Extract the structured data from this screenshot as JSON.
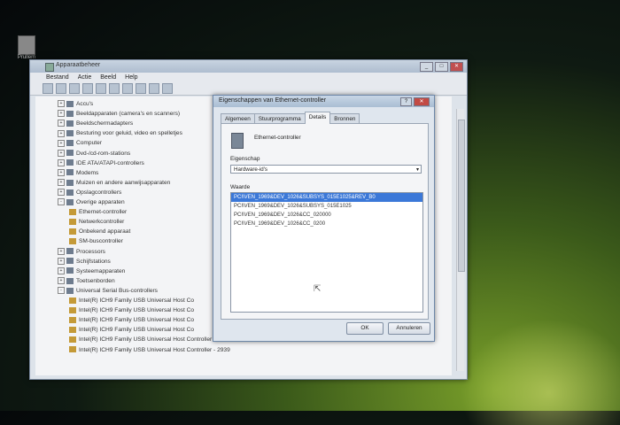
{
  "desktop": {
    "icon_label": "Prullem"
  },
  "device_manager": {
    "title": "Apparaatbeheer",
    "window_buttons": [
      "_",
      "□",
      "✕"
    ],
    "menu": [
      "Bestand",
      "Actie",
      "Beeld",
      "Help"
    ],
    "tree": [
      {
        "label": "Accu's",
        "level": 1,
        "expander": "+"
      },
      {
        "label": "Beeldapparaten (camera's en scanners)",
        "level": 1,
        "expander": "+"
      },
      {
        "label": "Beeldschermadapters",
        "level": 1,
        "expander": "+"
      },
      {
        "label": "Besturing voor geluid, video en spelletjes",
        "level": 1,
        "expander": "+"
      },
      {
        "label": "Computer",
        "level": 1,
        "expander": "+"
      },
      {
        "label": "Dvd-/cd-rom-stations",
        "level": 1,
        "expander": "+"
      },
      {
        "label": "IDE ATA/ATAPI-controllers",
        "level": 1,
        "expander": "+"
      },
      {
        "label": "Modems",
        "level": 1,
        "expander": "+"
      },
      {
        "label": "Muizen en andere aanwijsapparaten",
        "level": 1,
        "expander": "+"
      },
      {
        "label": "Opslagcontrollers",
        "level": 1,
        "expander": "+"
      },
      {
        "label": "Overige apparaten",
        "level": 1,
        "expander": "-"
      },
      {
        "label": "Ethernet-controller",
        "level": 2,
        "expander": ""
      },
      {
        "label": "Netwerkcontroller",
        "level": 2,
        "expander": ""
      },
      {
        "label": "Onbekend apparaat",
        "level": 2,
        "expander": ""
      },
      {
        "label": "SM-buscontroller",
        "level": 2,
        "expander": ""
      },
      {
        "label": "Processors",
        "level": 1,
        "expander": "+"
      },
      {
        "label": "Schijfstations",
        "level": 1,
        "expander": "+"
      },
      {
        "label": "Systeemapparaten",
        "level": 1,
        "expander": "+"
      },
      {
        "label": "Toetsenborden",
        "level": 1,
        "expander": "+"
      },
      {
        "label": "Universal Serial Bus-controllers",
        "level": 1,
        "expander": "-"
      },
      {
        "label": "Intel(R) ICH9 Family USB Universal Host Co",
        "level": 2,
        "expander": ""
      },
      {
        "label": "Intel(R) ICH9 Family USB Universal Host Co",
        "level": 2,
        "expander": ""
      },
      {
        "label": "Intel(R) ICH9 Family USB Universal Host Co",
        "level": 2,
        "expander": ""
      },
      {
        "label": "Intel(R) ICH9 Family USB Universal Host Co",
        "level": 2,
        "expander": ""
      },
      {
        "label": "Intel(R) ICH9 Family USB Universal Host Controller - 2938",
        "level": 2,
        "expander": ""
      },
      {
        "label": "Intel(R) ICH9 Family USB Universal Host Controller - 2939",
        "level": 2,
        "expander": ""
      }
    ]
  },
  "dialog": {
    "title": "Eigenschappen van Ethernet-controller",
    "title_buttons": [
      "?",
      "✕"
    ],
    "tabs": [
      "Algemeen",
      "Stuurprogramma",
      "Details",
      "Bronnen"
    ],
    "active_tab": "Details",
    "device_name": "Ethernet-controller",
    "property_label": "Eigenschap",
    "property_value": "Hardware-id's",
    "value_label": "Waarde",
    "values": [
      "PCI\\VEN_1969&DEV_1026&SUBSYS_015E1025&REV_B0",
      "PCI\\VEN_1969&DEV_1026&SUBSYS_015E1025",
      "PCI\\VEN_1969&DEV_1026&CC_020000",
      "PCI\\VEN_1969&DEV_1026&CC_0200"
    ],
    "ok_label": "OK",
    "cancel_label": "Annuleren"
  }
}
